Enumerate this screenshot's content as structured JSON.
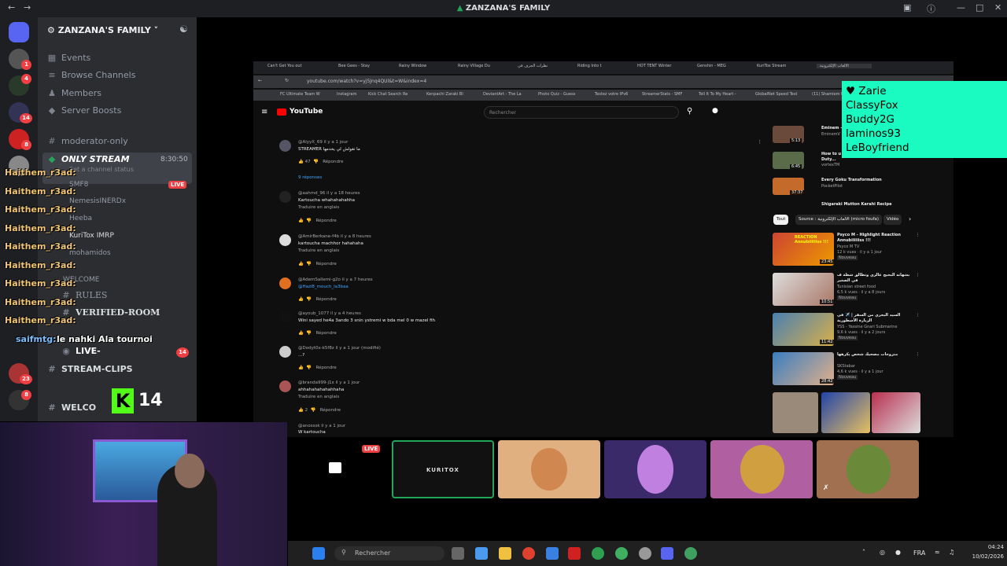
{
  "window": {
    "title": "ZANZANA'S FAMILY"
  },
  "rail": {
    "badges": [
      "1",
      "4",
      "14",
      "8",
      "23",
      "8"
    ]
  },
  "sidebar": {
    "server_name": "ZANZANA'S FAMILY",
    "items": [
      {
        "label": "Events"
      },
      {
        "label": "Browse Channels"
      },
      {
        "label": "Members"
      },
      {
        "label": "Server Boosts"
      }
    ],
    "channels": [
      {
        "label": "moderator-only"
      },
      {
        "label": "ONLY STREAM",
        "time": "8:30:50",
        "status": "Set a channel status"
      },
      {
        "label": "RULES"
      },
      {
        "label": "VERIFIED-ROOM"
      },
      {
        "label": "LIVE-",
        "badge": "14"
      },
      {
        "label": "STREAM-CLIPS"
      },
      {
        "label": "WELCO"
      }
    ],
    "members": [
      "SMF8",
      "NemesisINERDx",
      "Heeba",
      "KuriTox",
      "mohamidos"
    ],
    "welcome_label": "WELCOME",
    "member_live": "LIVE",
    "imrp": "IMRP"
  },
  "chat": {
    "lines": [
      {
        "user": "Haithem_r3ad:"
      },
      {
        "user": "Haithem_r3ad:"
      },
      {
        "user": "Haithem_r3ad:"
      },
      {
        "user": "Haithem_r3ad:"
      },
      {
        "user": "Haithem_r3ad:"
      },
      {
        "user": "Haithem_r3ad:"
      },
      {
        "user": "Haithem_r3ad:"
      },
      {
        "user": "Haithem_r3ad:"
      },
      {
        "user": "Haithem_r3ad:"
      }
    ],
    "saifmtg_user": "saifmtg:",
    "saifmtg_msg": "le nahki Ala tournoi",
    "kick_count": "14"
  },
  "browser": {
    "tabs": [
      "Can't Get You out",
      "Bee Gees - Stay",
      "Rainy Window",
      "Rainy Village Du",
      "نظرات الجرف في",
      "Riding Into t",
      "HOT TENT Winter",
      "Genshin - MEG",
      "KuriTox Stream",
      "الالعاب الإلكترونية"
    ],
    "url": "youtube.com/watch?v=yj5Jnq4QUl&t=W&index=4",
    "bookmarks": [
      "FC Ultimate Team W",
      "Instagram",
      "Kick Chat Search Re",
      "Kenpachi Zaraki Bl",
      "DeviantArt - The La",
      "Photo Quiz - Guess",
      "Testez votre IPv6",
      "StreamerStats - SMF",
      "Tell It To My Heart -",
      "GlobalNet Speed Test",
      "(11) Shamiem M"
    ]
  },
  "youtube": {
    "logo": "YouTube",
    "search_placeholder": "Rechercher",
    "comments": [
      {
        "author": "@AlyyX_69",
        "time": "il y a 1 jour",
        "text": "STREAMER ما تقولش لي يخدمها",
        "likes": "47",
        "reply": "Répondre",
        "replies": "9 réponses"
      },
      {
        "author": "@aahmd_96",
        "time": "il y a 18 heures",
        "text": "Kartoucha whahahahahha",
        "translate": "Traduire en anglais",
        "reply": "Répondre"
      },
      {
        "author": "@AmirBerkane-f4b",
        "time": "il y a 8 heures",
        "text": "kartoucha machhor hahahaha",
        "translate": "Traduire en anglais",
        "reply": "Répondre"
      },
      {
        "author": "@AdemSallemi-g2o",
        "time": "il y a 7 heures",
        "text": "@Hazi8_mouch_la3baa",
        "reply": "Répondre"
      },
      {
        "author": "@ayoub_1077",
        "time": "il y a 4 heures",
        "text": "Wini sayed he4a 3ando 3 snin ystremi w bda mel 0 w mazel fih",
        "reply": "Répondre"
      },
      {
        "author": "@Dodyt0x-k5f8z",
        "time": "il y a 1 jour (modifié)",
        "text": "...?",
        "reply": "Répondre"
      },
      {
        "author": "@branda999-j1x",
        "time": "il y a 1 jour",
        "text": "ahhahahahahahhaha",
        "translate": "Traduire en anglais",
        "likes": "2",
        "reply": "Répondre"
      },
      {
        "author": "@anosssk",
        "time": "il y a 1 jour",
        "text": "W kartoucha"
      }
    ],
    "top_videos": [
      {
        "title": "Eminem - Closet (Lo",
        "channel": "EminemV",
        "duration": "5:13"
      },
      {
        "title": "How to u and Keyboard, Call of Duty...",
        "channel": "vortexTM",
        "duration": "6:45"
      },
      {
        "title": "Every Goku Transformation",
        "channel": "PocketPilot",
        "duration": "37:37"
      },
      {
        "title": "Shigaraki Mutton Karahi Recipe"
      }
    ],
    "chips": [
      "Tout",
      "Source : الالعاب الإلكترونية (micro foufa)",
      "Vidéo"
    ],
    "videos": [
      {
        "title": "Psyco M - Highlight Reaction Annubiiiiiiss !!!",
        "channel": "Psyco M TV",
        "stats": "12 k vues · il y a 1 jour",
        "new": "Nouveau",
        "duration": "23:45",
        "thumb_text": "REACTION Annubiiiiiiss !!!"
      },
      {
        "title": "بشهاته البحيح عالزي وتطالق شطة ف في الصغير",
        "channel": "Tunisian street food",
        "stats": "6,5 k vues · il y a 8 jours",
        "new": "Nouveau",
        "duration": "10:51"
      },
      {
        "title": "السيد البحري من السفر | ✈️ في الزيارة الأسطورية",
        "channel": "YSS - Yassine Gnari Submarine",
        "stats": "9,6 k vues · il y a 2 jours",
        "new": "Nouveau",
        "duration": "11:42"
      },
      {
        "title": "متزوجات مصحيك شخص يكرهها",
        "channel": "SKStabar",
        "stats": "4,6 k vues · il y a 1 jour",
        "new": "Nouveau",
        "duration": "28:42"
      }
    ]
  },
  "overlay": {
    "names": [
      "Zarie",
      "ClassyFox",
      "Buddy2G",
      "laminos93",
      "LeBoyfriend"
    ]
  },
  "streams": {
    "live_label": "LIVE",
    "kuritox_label": "KURITOX"
  },
  "taskbar": {
    "search_placeholder": "Rechercher",
    "lang": "FRA",
    "time": "04:24",
    "date": "10/02/2026"
  },
  "colors": {
    "discord_bg": "#1e1f22",
    "sidebar_bg": "#2b2d31",
    "names_bg": "#19fbc1",
    "chat_user": "#f0c674",
    "live_red": "#ed4245",
    "kick_green": "#53fc18"
  }
}
